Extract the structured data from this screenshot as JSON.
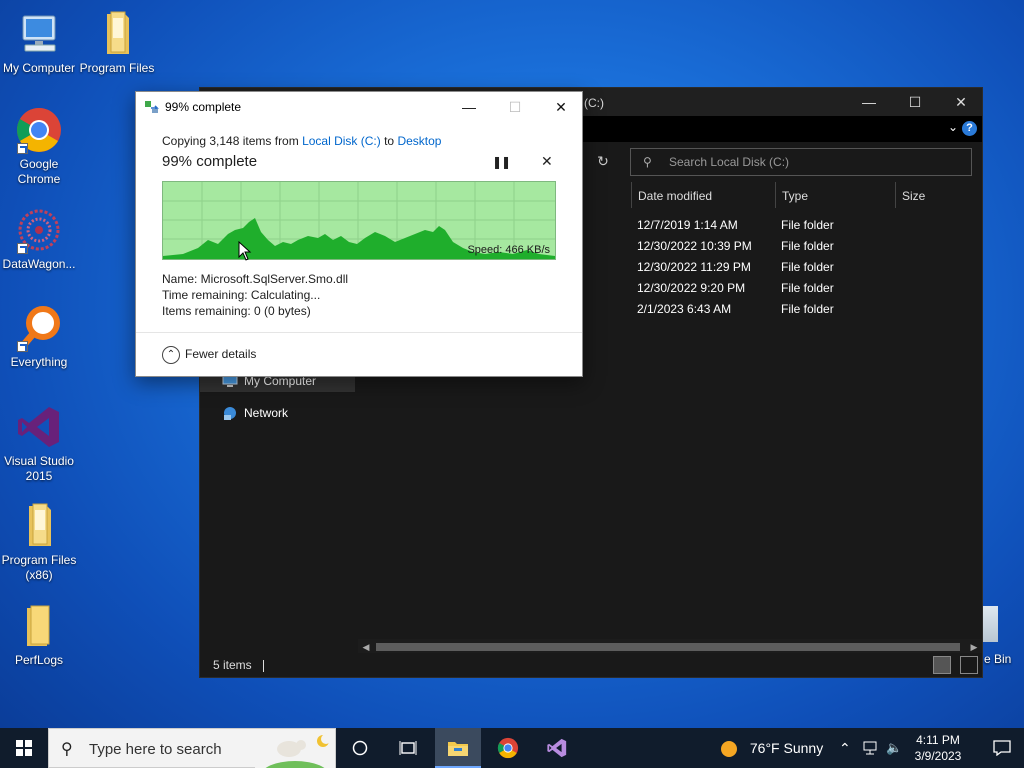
{
  "desktop": {
    "icons": [
      {
        "label": "My Computer"
      },
      {
        "label": "Program Files"
      },
      {
        "label": "Google Chrome"
      },
      {
        "label": "DataWagon..."
      },
      {
        "label": "Everything"
      },
      {
        "label": "Visual Studio 2015"
      },
      {
        "label": "Program Files (x86)"
      },
      {
        "label": "PerfLogs"
      }
    ],
    "recycle_bin_label": "e Bin"
  },
  "explorer": {
    "title": "(C:)",
    "search_placeholder": "Search Local Disk (C:)",
    "nav_items": [
      {
        "label": "My Computer",
        "selected": true
      },
      {
        "label": "Network",
        "selected": false
      }
    ],
    "columns": [
      "Date modified",
      "Type",
      "Size"
    ],
    "rows": [
      {
        "date": "12/7/2019 1:14 AM",
        "type": "File folder"
      },
      {
        "date": "12/30/2022 10:39 PM",
        "type": "File folder"
      },
      {
        "date": "12/30/2022 11:29 PM",
        "type": "File folder"
      },
      {
        "date": "12/30/2022 9:20 PM",
        "type": "File folder"
      },
      {
        "date": "2/1/2023 6:43 AM",
        "type": "File folder"
      }
    ],
    "status": "5 items",
    "help_label": "?"
  },
  "dialog": {
    "title": "99% complete",
    "copy_prefix": "Copying 3,148 items from ",
    "source": "Local Disk (C:)",
    "to_word": " to ",
    "destination": "Desktop",
    "heading": "99% complete",
    "progress_percent": 99,
    "speed": "Speed: 466 KB/s",
    "name_line": "Name:  Microsoft.SqlServer.Smo.dll",
    "time_line": "Time remaining:  Calculating...",
    "items_line": "Items remaining:  0 (0 bytes)",
    "fewer_details": "Fewer details",
    "colors": {
      "graph_bg": "#a6e8a0",
      "graph_fill": "#1fae2c"
    }
  },
  "taskbar": {
    "search_placeholder": "Type here to search",
    "weather": "76°F  Sunny",
    "time": "4:11 PM",
    "date": "3/9/2023"
  }
}
